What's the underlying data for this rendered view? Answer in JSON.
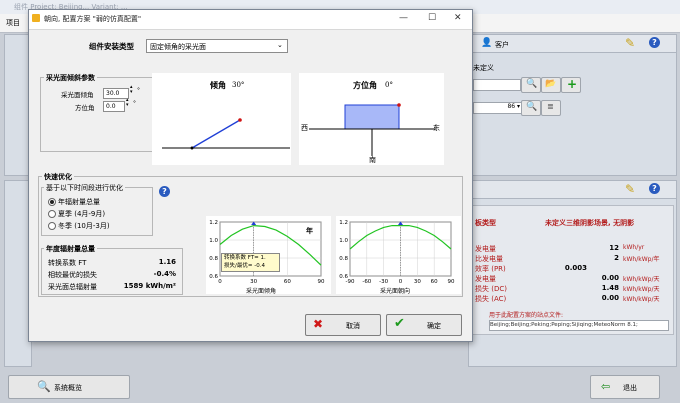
{
  "app": {
    "title": "组件 Project: Beijing... Variant: ...",
    "menu_item": "项目"
  },
  "dialog": {
    "title": "朝向, 配置方案 \"弱的仿真配置\"",
    "mount_label": "组件安装类型",
    "mount_value": "固定倾角的采光面",
    "params": {
      "title": "采光面倾斜参数",
      "tilt_label": "采光面倾角",
      "tilt_value": "30.0",
      "azimuth_label": "方位角",
      "azimuth_value": "0.0",
      "unit": "°"
    },
    "tilt_diagram": {
      "label": "倾角",
      "value": "30°"
    },
    "azimuth_diagram": {
      "label": "方位角",
      "value": "0°",
      "west": "西",
      "east": "东",
      "south": "南"
    },
    "optimize": {
      "title": "快速优化",
      "basis_title": "基于以下时间段进行优化",
      "options": [
        "年辐射量总量",
        "夏季 (4月-9月)",
        "冬季 (10月-3月)"
      ],
      "selected_index": 0,
      "help": "?"
    },
    "annual": {
      "title": "年度辐射量总量",
      "rows": [
        {
          "label": "转换系数 FT",
          "value": "1.16"
        },
        {
          "label": "相较最优的损失",
          "value": "-0.4%"
        },
        {
          "label": "采光面总辐射量",
          "value": "1589 kWh/m²"
        }
      ]
    },
    "chart_tilt": {
      "xlabel": "采光面倾角",
      "tag": "年",
      "tooltip_line1": "转换系数 FT= 1.",
      "tooltip_line2": "损失/最优= -0.4"
    },
    "chart_azimuth": {
      "xlabel": "采光面朝向"
    },
    "cancel": "取消",
    "ok": "确定"
  },
  "right_panel": {
    "customer_label": "客户",
    "undefined": "未定义",
    "select_value": "86",
    "results_type_label": "板类型",
    "results_type_value": "未定义三维阴影场景, 无阴影",
    "rows": [
      {
        "label": "发电量",
        "value": "12",
        "unit": "kWh/yr"
      },
      {
        "label": "比发电量",
        "value": "2",
        "unit": "kWh/kWp/年"
      },
      {
        "label": "效率 (PR)",
        "value": "0.003",
        "unit": ""
      },
      {
        "label": "发电量",
        "value": "0.00",
        "unit": "kWh/kWp/天"
      },
      {
        "label": "损失 (DC)",
        "value": "1.48",
        "unit": "kWh/kWp/天"
      },
      {
        "label": "损失 (AC)",
        "value": "0.00",
        "unit": "kWh/kWp/天"
      }
    ],
    "site_file_label": "用于此配置方案的站点文件:",
    "site_file_value": "Beijing;Beijing;Peking;Peping;Sijiqing;MeteoNorm 8.1;"
  },
  "bottom": {
    "overview": "系统概览",
    "exit": "退出"
  },
  "chart_data": [
    {
      "type": "line",
      "title": "",
      "xlabel": "采光面倾角",
      "ylabel": "",
      "x": [
        0,
        10,
        20,
        30,
        40,
        50,
        60,
        70,
        80,
        90
      ],
      "series": [
        {
          "values": [
            0.95,
            1.05,
            1.12,
            1.16,
            1.15,
            1.11,
            1.04,
            0.95,
            0.84,
            0.72
          ]
        }
      ],
      "xlim": [
        0,
        90
      ],
      "ylim": [
        0.6,
        1.2
      ],
      "xticks": [
        0,
        30,
        60,
        90
      ],
      "yticks": [
        0.6,
        0.8,
        1.0,
        1.2
      ],
      "marker_x": 30,
      "grid": true
    },
    {
      "type": "line",
      "title": "",
      "xlabel": "采光面朝向",
      "ylabel": "",
      "x": [
        -90,
        -75,
        -60,
        -45,
        -30,
        -15,
        0,
        15,
        30,
        45,
        60,
        75,
        90
      ],
      "series": [
        {
          "values": [
            0.9,
            0.98,
            1.05,
            1.1,
            1.14,
            1.16,
            1.16,
            1.16,
            1.14,
            1.1,
            1.05,
            0.98,
            0.9
          ]
        }
      ],
      "xlim": [
        -90,
        90
      ],
      "ylim": [
        0.6,
        1.2
      ],
      "xticks": [
        -90,
        -60,
        -30,
        0,
        30,
        60,
        90
      ],
      "yticks": [
        0.6,
        0.8,
        1.0,
        1.2
      ],
      "marker_x": 0,
      "grid": true
    }
  ]
}
